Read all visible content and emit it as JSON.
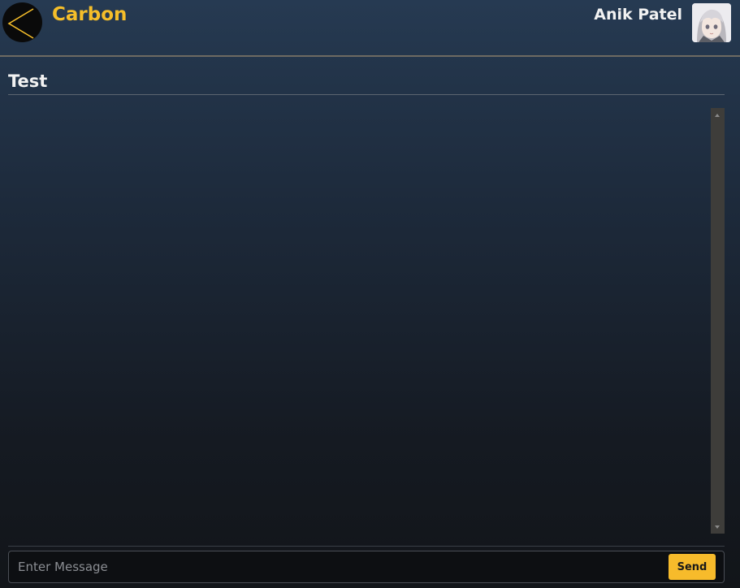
{
  "header": {
    "app_title": "Carbon",
    "user_name": "Anik Patel",
    "back_icon": "chevron-left-icon",
    "avatar_icon": "avatar-icon"
  },
  "room": {
    "title": "Test"
  },
  "composer": {
    "placeholder": "Enter Message",
    "value": "",
    "send_label": "Send"
  },
  "colors": {
    "accent": "#f5be2a",
    "send_button": "#f7bb2b",
    "back_button_bg": "#0a0a0a"
  }
}
